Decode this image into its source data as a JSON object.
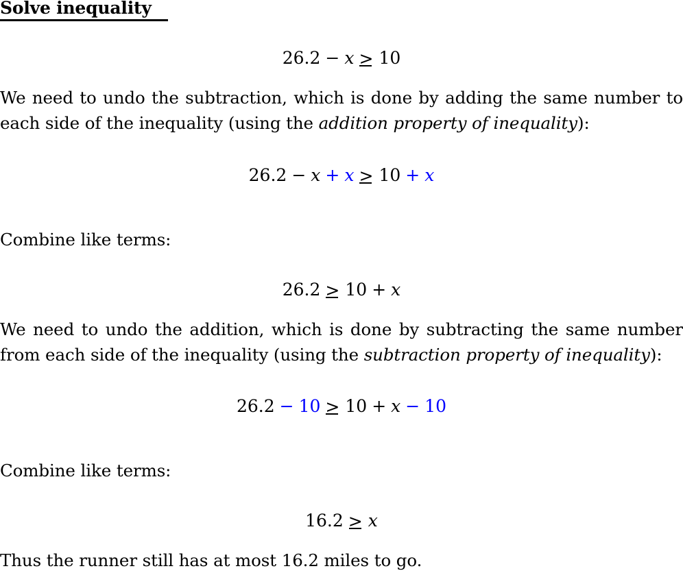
{
  "document": {
    "title": "Solve inequality",
    "accent_color": "#0000ff",
    "text_color": "#000000",
    "background_color": "#ffffff"
  },
  "equations": {
    "eq1": {
      "lhs_number": "26.2",
      "minus": "−",
      "lhs_var": "x",
      "relation": "≥",
      "rhs": "10"
    },
    "eq2": {
      "lhs_number": "26.2",
      "minus": "−",
      "lhs_var": "x",
      "add_op": "+",
      "add_var": "x",
      "relation": "≥",
      "rhs_number": "10",
      "rhs_add_op": "+",
      "rhs_add_var": "x"
    },
    "eq3": {
      "lhs_number": "26.2",
      "relation": "≥",
      "rhs_number": "10",
      "plus": "+",
      "rhs_var": "x"
    },
    "eq4": {
      "lhs_number": "26.2",
      "sub_op": "−",
      "sub_value": "10",
      "relation": "≥",
      "rhs_number": "10",
      "plus": "+",
      "rhs_var": "x",
      "rhs_sub_op": "−",
      "rhs_sub_value": "10"
    },
    "eq5": {
      "lhs_number": "16.2",
      "relation": "≥",
      "rhs_var": "x"
    }
  },
  "paragraphs": {
    "p1_before_italic": "We need to undo the subtraction, which is done by adding the same number to each side of the inequality (using the ",
    "p1_italic": "addition property of inequality",
    "p1_after_italic": "):",
    "combine1": "Combine like terms:",
    "p2_before_italic": "We need to undo the addition, which is done by subtracting the same number from each side of the inequality (using the ",
    "p2_italic": "subtraction property of inequality",
    "p2_after_italic": "):",
    "combine2": "Combine like terms:",
    "conclusion": "Thus the runner still has at most 16.2 miles to go."
  }
}
